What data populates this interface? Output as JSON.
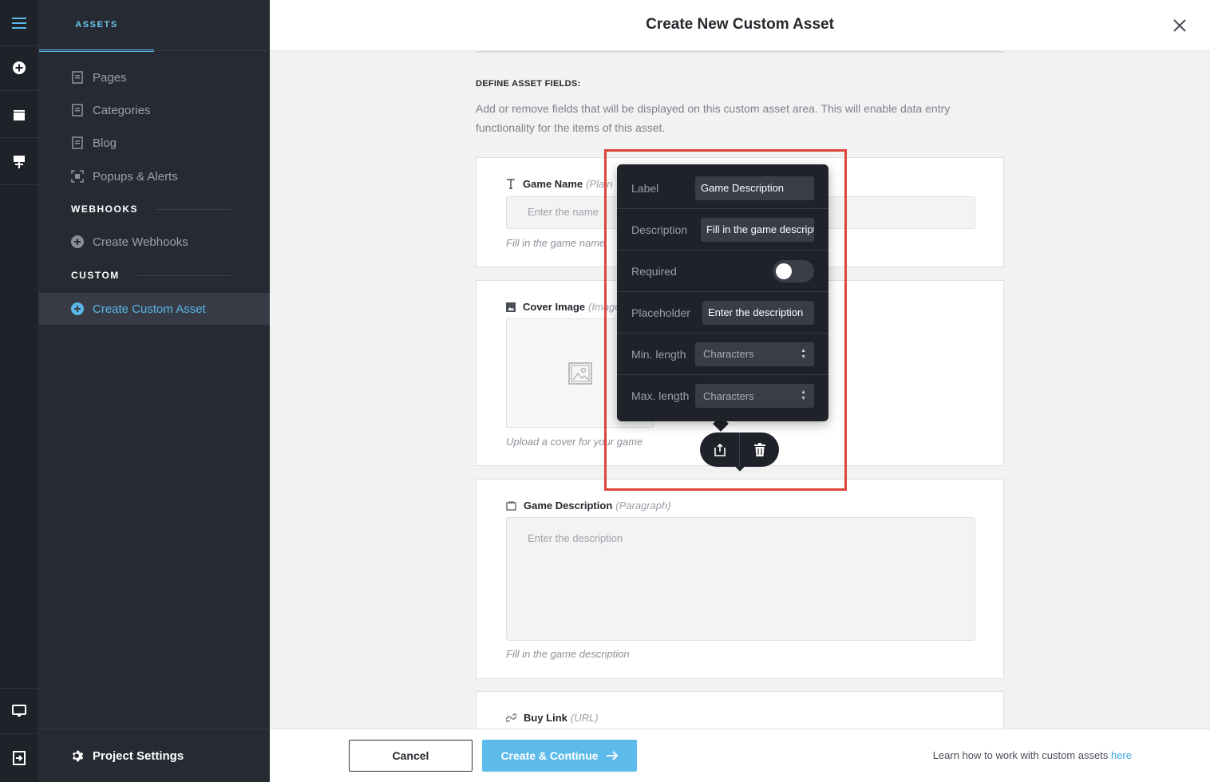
{
  "sidebar": {
    "tab": "ASSETS",
    "items": [
      {
        "label": "Pages"
      },
      {
        "label": "Categories"
      },
      {
        "label": "Blog"
      },
      {
        "label": "Popups & Alerts"
      }
    ],
    "webhooks_heading": "WEBHOOKS",
    "webhooks_item": "Create Webhooks",
    "custom_heading": "CUSTOM",
    "custom_item": "Create Custom Asset",
    "settings": "Project Settings"
  },
  "header": {
    "title": "Create New Custom Asset"
  },
  "main": {
    "section_title": "DEFINE ASSET FIELDS:",
    "section_desc": "Add or remove fields that will be displayed on this custom asset area. This will enable data entry functionality for the items of this asset.",
    "fields": [
      {
        "name": "Game Name",
        "type": "(Plain",
        "placeholder": "Enter the name",
        "help": "Fill in the game name"
      },
      {
        "name": "Cover Image",
        "type": "(Image",
        "help": "Upload a cover for your game"
      },
      {
        "name": "Game Description",
        "type": "(Paragraph)",
        "placeholder": "Enter the description",
        "help": "Fill in the game description"
      },
      {
        "name": "Buy Link",
        "type": "(URL)"
      }
    ]
  },
  "popover": {
    "label_label": "Label",
    "label_value": "Game Description",
    "description_label": "Description",
    "description_value": "Fill in the game description",
    "required_label": "Required",
    "required_on": false,
    "placeholder_label": "Placeholder",
    "placeholder_value": "Enter the description",
    "min_label": "Min. length",
    "min_placeholder": "Characters",
    "max_label": "Max. length",
    "max_placeholder": "Characters"
  },
  "footer": {
    "cancel": "Cancel",
    "create": "Create & Continue",
    "learn_text": "Learn how to work with custom assets",
    "learn_link": "here"
  },
  "colors": {
    "accent": "#5cbbea",
    "sidebar_bg": "#262a33",
    "rail_bg": "#1f2229",
    "highlight": "#e0433a"
  }
}
